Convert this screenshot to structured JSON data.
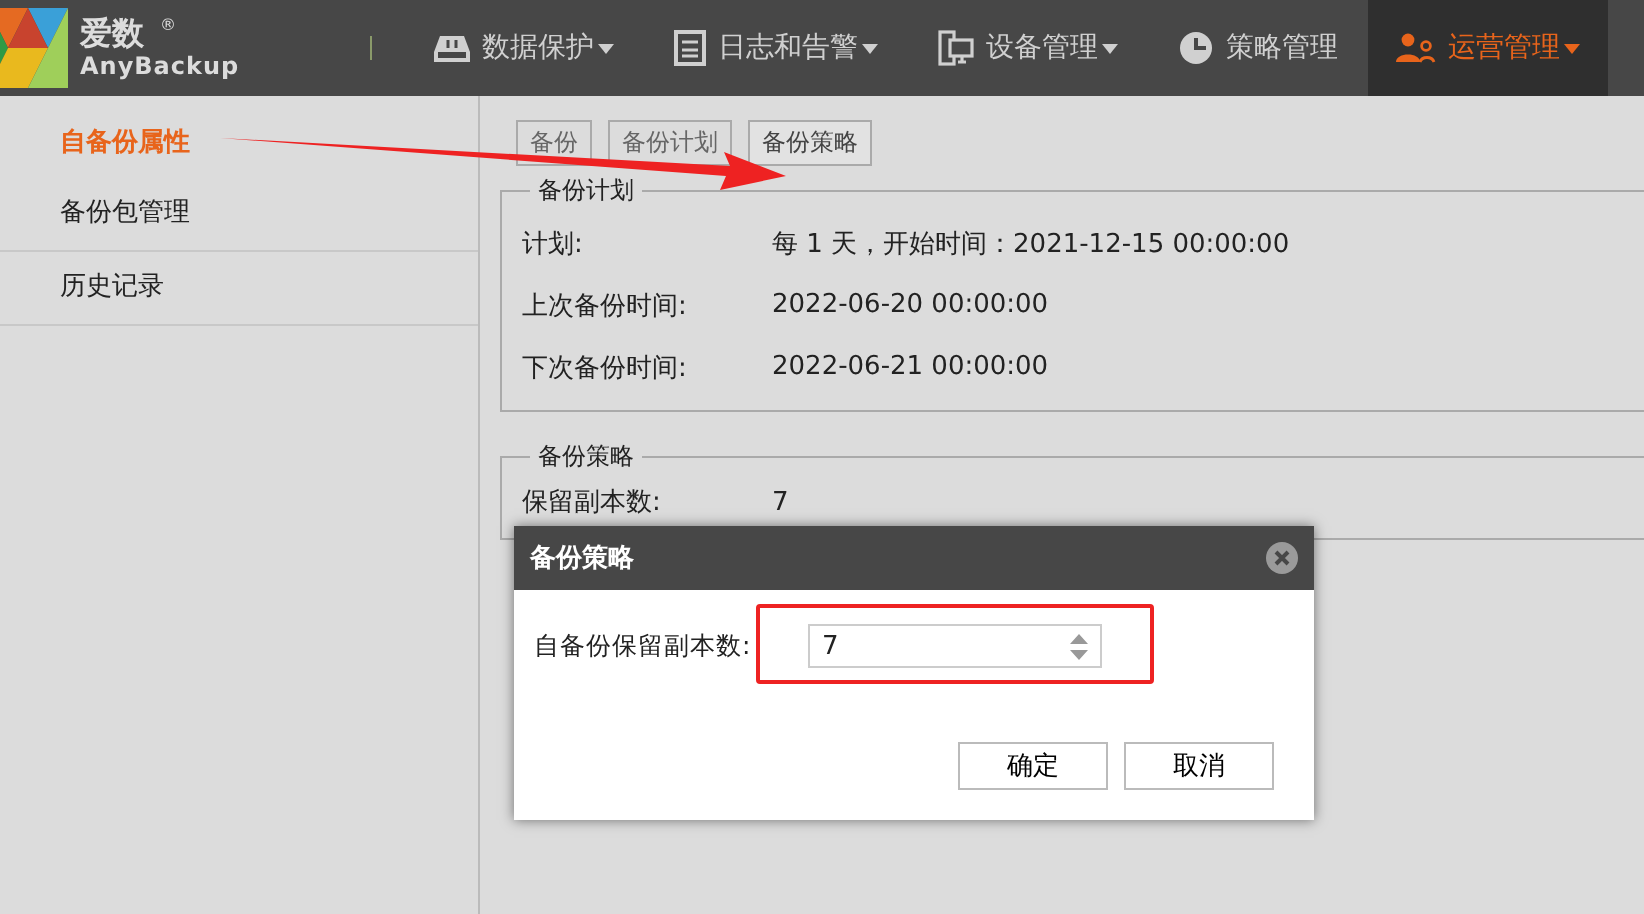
{
  "logo": {
    "name": "爱数",
    "sub": "AnyBackup",
    "mark": "®"
  },
  "nav": [
    {
      "label": "数据保护",
      "kind": "drive",
      "dropdown": true,
      "selected": false
    },
    {
      "label": "日志和告警",
      "kind": "doc",
      "dropdown": true,
      "selected": false
    },
    {
      "label": "设备管理",
      "kind": "devices",
      "dropdown": true,
      "selected": false
    },
    {
      "label": "策略管理",
      "kind": "pie",
      "dropdown": false,
      "selected": false
    },
    {
      "label": "运营管理",
      "kind": "users",
      "dropdown": true,
      "selected": true
    }
  ],
  "sidebar": {
    "items": [
      {
        "label": "自备份属性",
        "selected": true
      },
      {
        "label": "备份包管理",
        "selected": false
      },
      {
        "label": "历史记录",
        "selected": false
      }
    ]
  },
  "tabs": [
    {
      "label": "备份",
      "selected": false
    },
    {
      "label": "备份计划",
      "selected": false
    },
    {
      "label": "备份策略",
      "selected": true
    }
  ],
  "sections": [
    {
      "title": "备份计划",
      "rows": [
        {
          "label": "计划:",
          "value": "每 1 天，开始时间：2021-12-15 00:00:00"
        },
        {
          "label": "上次备份时间:",
          "value": "2022-06-20 00:00:00"
        },
        {
          "label": "下次备份时间:",
          "value": "2022-06-21 00:00:00"
        }
      ]
    },
    {
      "title": "备份策略",
      "rows": [
        {
          "label": "保留副本数:",
          "value": "7"
        }
      ]
    }
  ],
  "dialog": {
    "title": "备份策略",
    "field_label": "自备份保留副本数:",
    "field_value": "7",
    "buttons": [
      "确定",
      "取消"
    ]
  }
}
